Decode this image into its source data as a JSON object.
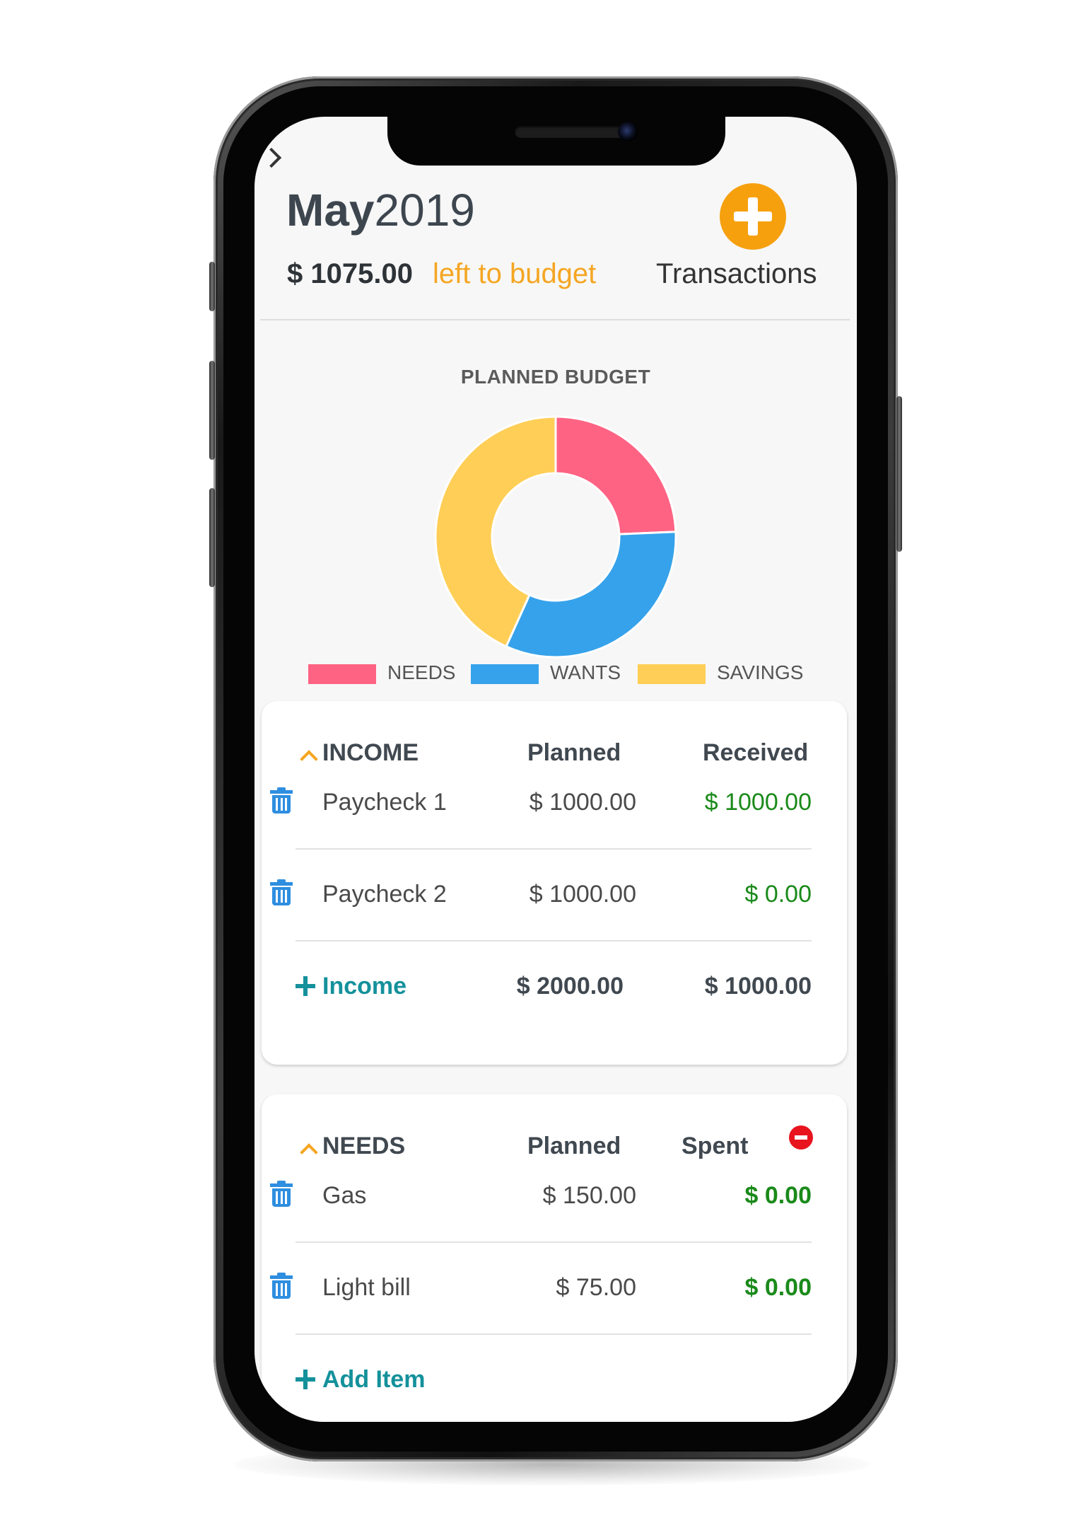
{
  "header": {
    "month": "May",
    "year": "2019",
    "left_amount": "$ 1075.00",
    "left_label": "left to budget",
    "transactions_label": "Transactions"
  },
  "chart_data": {
    "type": "pie",
    "title": "PLANNED BUDGET",
    "categories": [
      "NEEDS",
      "WANTS",
      "SAVINGS"
    ],
    "values": [
      225,
      300,
      400
    ],
    "colors": [
      "#ff6384",
      "#36a2eb",
      "#ffce56"
    ],
    "donut": true,
    "legend_position": "bottom"
  },
  "income": {
    "title": "INCOME",
    "col_planned": "Planned",
    "col_received": "Received",
    "rows": [
      {
        "name": "Paycheck 1",
        "planned": "$ 1000.00",
        "received": "$ 1000.00"
      },
      {
        "name": "Paycheck 2",
        "planned": "$ 1000.00",
        "received": "$ 0.00"
      }
    ],
    "add_label": "Income",
    "total_planned": "$ 2000.00",
    "total_received": "$ 1000.00"
  },
  "needs": {
    "title": "NEEDS",
    "col_planned": "Planned",
    "col_spent": "Spent",
    "rows": [
      {
        "name": "Gas",
        "planned": "$ 150.00",
        "spent": "$ 0.00"
      },
      {
        "name": "Light bill",
        "planned": "$ 75.00",
        "spent": "$ 0.00"
      }
    ],
    "add_label": "Add Item"
  }
}
